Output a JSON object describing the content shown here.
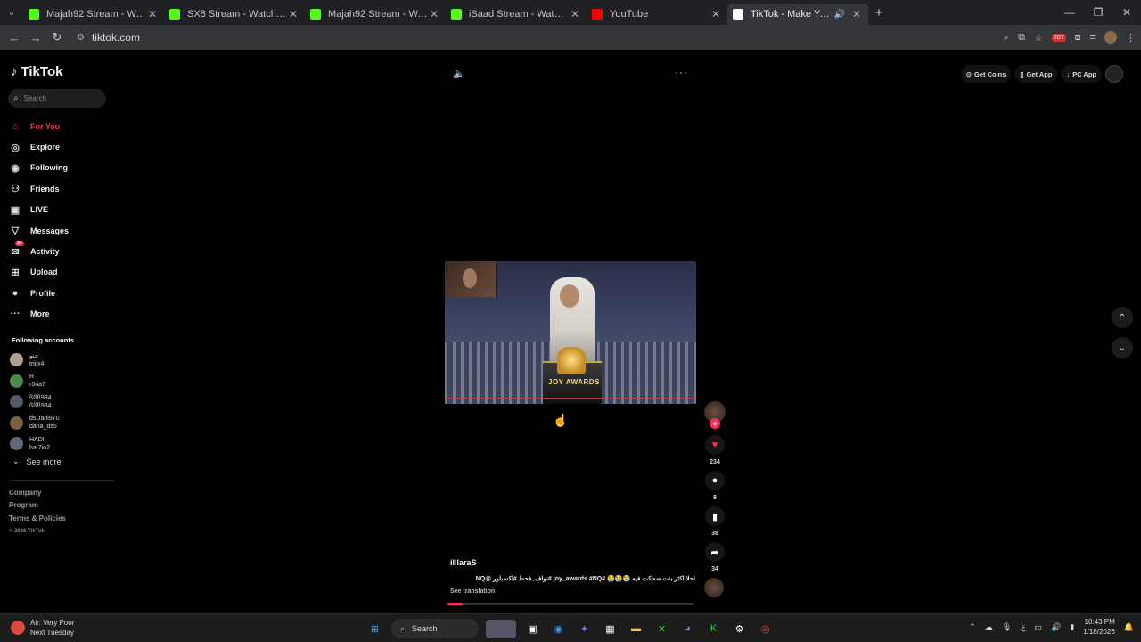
{
  "browser": {
    "tabs": [
      {
        "title": "Majah92 Stream - Watch Live o",
        "favicon": "kick-icon",
        "color": "#53fc18"
      },
      {
        "title": "SX8 Stream - Watch Live on Ki",
        "favicon": "kick-icon",
        "color": "#53fc18"
      },
      {
        "title": "Majah92 Stream - Watch Live o",
        "favicon": "kick-icon",
        "color": "#53fc18"
      },
      {
        "title": "iSaad Stream - Watch Live on K",
        "favicon": "kick-icon",
        "color": "#53fc18"
      },
      {
        "title": "YouTube",
        "favicon": "youtube-icon",
        "color": "#ff0000"
      },
      {
        "title": "TikTok - Make Your Day",
        "favicon": "tiktok-icon",
        "color": "#ffffff"
      }
    ],
    "url": "tiktok.com",
    "extension_badge": "207"
  },
  "app": {
    "logo": "TikTok",
    "search_placeholder": "Search",
    "nav": [
      {
        "label": "For You",
        "icon": "home-icon"
      },
      {
        "label": "Explore",
        "icon": "compass-icon"
      },
      {
        "label": "Following",
        "icon": "following-icon"
      },
      {
        "label": "Friends",
        "icon": "friends-icon"
      },
      {
        "label": "LIVE",
        "icon": "live-icon"
      },
      {
        "label": "Messages",
        "icon": "messages-icon"
      },
      {
        "label": "Activity",
        "icon": "activity-icon",
        "badge": "24"
      },
      {
        "label": "Upload",
        "icon": "upload-icon"
      },
      {
        "label": "Profile",
        "icon": "profile-icon"
      },
      {
        "label": "More",
        "icon": "more-icon"
      }
    ],
    "following_title": "Following accounts",
    "following": [
      {
        "name": "جنو",
        "handle": "triijx4",
        "color": "#b0a090"
      },
      {
        "name": "R",
        "handle": "r0ria7",
        "color": "#4a8a4a"
      },
      {
        "name": "ßßß984",
        "handle": "ßßß984",
        "color": "#555a6a"
      },
      {
        "name": "dsDani970",
        "handle": "dana_ds5",
        "color": "#7a6040"
      },
      {
        "name": "HADI",
        "handle": "ha.7io2",
        "color": "#606a7a"
      }
    ],
    "see_more": "See more",
    "footer": {
      "company": "Company",
      "program": "Program",
      "terms": "Terms & Policies",
      "copyright": "© 2026 TikTok"
    },
    "top_buttons": {
      "coins": "Get Coins",
      "app": "Get App",
      "pc": "PC App"
    }
  },
  "video": {
    "podium_text": "JOY AWARDS",
    "author": "illlaraS",
    "description": "احلا اكثر بنت ضحكت فيه 😭😭😭 #joy_awards #NQ #نواف_فحط #اكسبلور @NQ",
    "see_translation": "See translation",
    "likes": "234",
    "comments": "8",
    "saves": "38",
    "shares": "34",
    "progress": 0.06
  },
  "taskbar": {
    "weather_title": "Air: Very Poor",
    "weather_sub": "Next Tuesday",
    "search": "Search",
    "time": "10:43 PM",
    "date": "1/18/2026",
    "lang": "ع"
  }
}
